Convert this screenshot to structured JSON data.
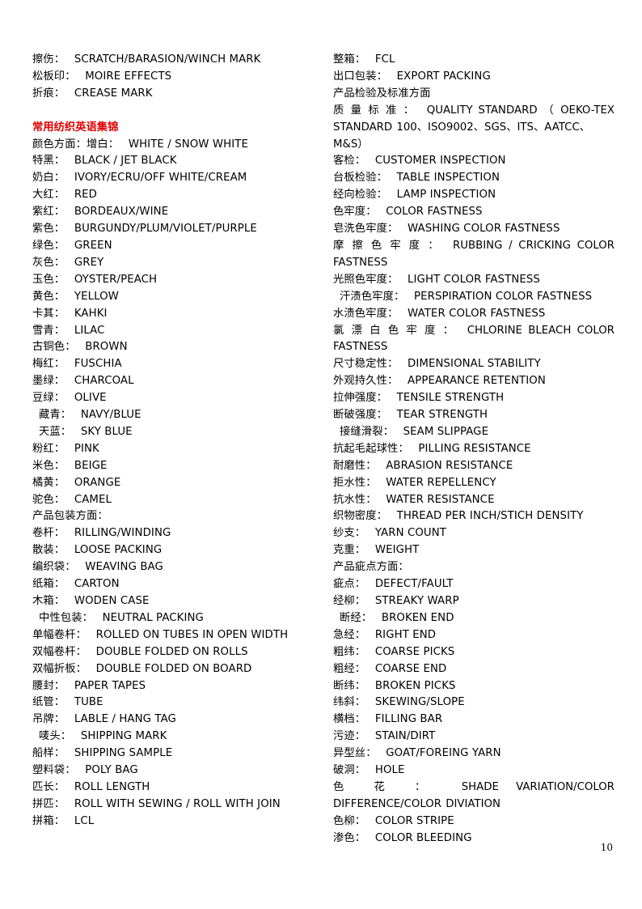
{
  "page": {
    "number": "10"
  },
  "heading": {
    "text": "常用纺织英语集锦",
    "color": "#e00000"
  },
  "left_column": [
    {
      "cn": "擦伤：",
      "en": "SCRATCH/BARASION/WINCH  MARK"
    },
    {
      "cn": "松板印：",
      "en": "MOIRE EFFECTS"
    },
    {
      "cn": "折痕：",
      "en": "CREASE MARK"
    },
    {
      "cn": "",
      "en": ""
    },
    {
      "cn": "常用纺织英语集锦",
      "en": "",
      "style": "heading"
    },
    {
      "cn": "颜色方面：增白：",
      "en": "WHITE / SNOW WHITE"
    },
    {
      "cn": "特黑：",
      "en": "BLACK / JET BLACK"
    },
    {
      "cn": "奶白：",
      "en": "IVORY/ECRU/OFF  WHITE/CREAM"
    },
    {
      "cn": "大红：",
      "en": "RED"
    },
    {
      "cn": "紫红：",
      "en": "BORDEAUX/WINE"
    },
    {
      "cn": "紫色：",
      "en": "BURGUNDY/PLUM/VIOLET/PURPLE"
    },
    {
      "cn": "绿色：",
      "en": "GREEN"
    },
    {
      "cn": "灰色：",
      "en": "GREY"
    },
    {
      "cn": "玉色：",
      "en": "OYSTER/PEACH"
    },
    {
      "cn": "黄色：",
      "en": "YELLOW"
    },
    {
      "cn": "卡其：",
      "en": "KAHKI"
    },
    {
      "cn": "雪青：",
      "en": "LILAC"
    },
    {
      "cn": "古铜色：",
      "en": "BROWN"
    },
    {
      "cn": "梅红：",
      "en": "FUSCHIA"
    },
    {
      "cn": "墨绿：",
      "en": "CHARCOAL"
    },
    {
      "cn": "豆绿：",
      "en": "OLIVE"
    },
    {
      "cn": "藏青：",
      "en": "NAVY/BLUE",
      "style": "indent"
    },
    {
      "cn": "天蓝：",
      "en": "SKY BLUE",
      "style": "indent"
    },
    {
      "cn": "粉红：",
      "en": "PINK"
    },
    {
      "cn": "米色：",
      "en": "BEIGE"
    },
    {
      "cn": "橘黄：",
      "en": "ORANGE"
    },
    {
      "cn": "驼色：",
      "en": "CAMEL"
    },
    {
      "cn": "产品包装方面：",
      "en": "",
      "style": "label"
    },
    {
      "cn": "卷杆：",
      "en": "RILLING/WINDING"
    },
    {
      "cn": "散装：",
      "en": "LOOSE PACKING"
    },
    {
      "cn": "编织袋：",
      "en": "WEAVING BAG"
    },
    {
      "cn": "纸箱：",
      "en": "CARTON"
    },
    {
      "cn": "木箱：",
      "en": "WODEN CASE"
    },
    {
      "cn": "中性包装：",
      "en": "NEUTRAL PACKING",
      "style": "indent"
    },
    {
      "cn": "单幅卷杆：",
      "en": "ROLLED ON TUBES IN OPEN WIDTH"
    },
    {
      "cn": "双幅卷杆：",
      "en": "DOUBLE FOLDED ON ROLLS"
    },
    {
      "cn": "双幅折板：",
      "en": "DOUBLE FOLDED ON BOARD"
    },
    {
      "cn": "腰封：",
      "en": "PAPER TAPES"
    },
    {
      "cn": "纸管：",
      "en": "TUBE"
    },
    {
      "cn": "吊牌：",
      "en": "LABLE / HANG TAG"
    },
    {
      "cn": "唛头：",
      "en": "SHIPPING  MARK",
      "style": "indent"
    },
    {
      "cn": "船样：",
      "en": "SHIPPING SAMPLE"
    },
    {
      "cn": "塑料袋：",
      "en": "POLY BAG"
    },
    {
      "cn": "匹长：",
      "en": "ROLL LENGTH"
    },
    {
      "cn": "拼匹：",
      "en": "ROLL WITH SEWING / ROLL WITH JOIN"
    },
    {
      "cn": "拼箱：",
      "en": "LCL"
    }
  ],
  "right_column": [
    {
      "cn": "整箱：",
      "en": "FCL"
    },
    {
      "cn": "出口包装：",
      "en": "EXPORT PACKING"
    },
    {
      "cn": "产品检验及标准方面",
      "en": "",
      "style": "label"
    },
    {
      "cn": "质 量 标 准 ：",
      "en": "QUALITY  STANDARD  （ OEKO-TEX",
      "tail": "STANDARD 100、ISO9002、SGS、ITS、AATCC、M&S）",
      "style": "justified"
    },
    {
      "cn": "客检：",
      "en": "CUSTOMER  INSPECTION"
    },
    {
      "cn": "台板检验：",
      "en": "TABLE  INSPECTION"
    },
    {
      "cn": "经向检验：",
      "en": "LAMP INSPECTION"
    },
    {
      "cn": "色牢度：",
      "en": "COLOR FASTNESS"
    },
    {
      "cn": "皂洗色牢度：",
      "en": "WASHING COLOR FASTNESS"
    },
    {
      "cn": "摩 擦 色 牢 度 ：",
      "en": "RUBBING / CRICKING  COLOR",
      "tail": "FASTNESS",
      "style": "justified"
    },
    {
      "cn": "光照色牢度：",
      "en": "LIGHT COLOR FASTNESS"
    },
    {
      "cn": "汗渍色牢度：",
      "en": "PERSPIRATION  COLOR FASTNESS",
      "style": "indent"
    },
    {
      "cn": "水渍色牢度：",
      "en": "WATER COLOR FASTNESS"
    },
    {
      "cn": "氯 漂 白 色 牢 度 ：",
      "en": "CHLORINE  BLEACH  COLOR",
      "tail": "FASTNESS",
      "style": "justified"
    },
    {
      "cn": "尺寸稳定性：",
      "en": "DIMENSIONAL STABILITY"
    },
    {
      "cn": "外观持久性：",
      "en": "APPEARANCE RETENTION"
    },
    {
      "cn": "拉伸强度：",
      "en": "TENSILE STRENGTH"
    },
    {
      "cn": "断破强度：",
      "en": "TEAR STRENGTH"
    },
    {
      "cn": "接缝滑裂：",
      "en": "SEAM SLIPPAGE",
      "style": "indent"
    },
    {
      "cn": "抗起毛起球性：",
      "en": "PILLING RESISTANCE"
    },
    {
      "cn": "耐磨性：",
      "en": "ABRASION RESISTANCE"
    },
    {
      "cn": "拒水性：",
      "en": "WATER REPELLENCY"
    },
    {
      "cn": "抗水性：",
      "en": "WATER RESISTANCE"
    },
    {
      "cn": "织物密度：",
      "en": "THREAD PER INCH/STICH DENSITY"
    },
    {
      "cn": "纱支：",
      "en": "YARN COUNT"
    },
    {
      "cn": "克重：",
      "en": "WEIGHT"
    },
    {
      "cn": "产品疵点方面：",
      "en": "",
      "style": "label"
    },
    {
      "cn": "疵点：",
      "en": "DEFECT/FAULT"
    },
    {
      "cn": "经柳：",
      "en": "STREAKY WARP"
    },
    {
      "cn": "断经：",
      "en": "BROKEN END",
      "style": "indent"
    },
    {
      "cn": "急经：",
      "en": "RIGHT END"
    },
    {
      "cn": "粗纬：",
      "en": "COARSE PICKS"
    },
    {
      "cn": "粗经：",
      "en": "COARSE END"
    },
    {
      "cn": "断纬：",
      "en": "BROKEN PICKS"
    },
    {
      "cn": "纬斜：",
      "en": "SKEWING/SLOPE"
    },
    {
      "cn": "横档：",
      "en": "FILLING BAR"
    },
    {
      "cn": "污迹：",
      "en": "STAIN/DIRT"
    },
    {
      "cn": "异型丝：",
      "en": "GOAT/FOREING YARN"
    },
    {
      "cn": "破洞：",
      "en": "HOLE"
    },
    {
      "cn": "色 花 ：",
      "en": "SHADE  VARIATION/COLOR",
      "tail": "DIFFERENCE/COLOR  DIVIATION",
      "style": "justified"
    },
    {
      "cn": "色柳：",
      "en": "COLOR STRIPE"
    },
    {
      "cn": "渗色：",
      "en": "COLOR BLEEDING"
    }
  ]
}
